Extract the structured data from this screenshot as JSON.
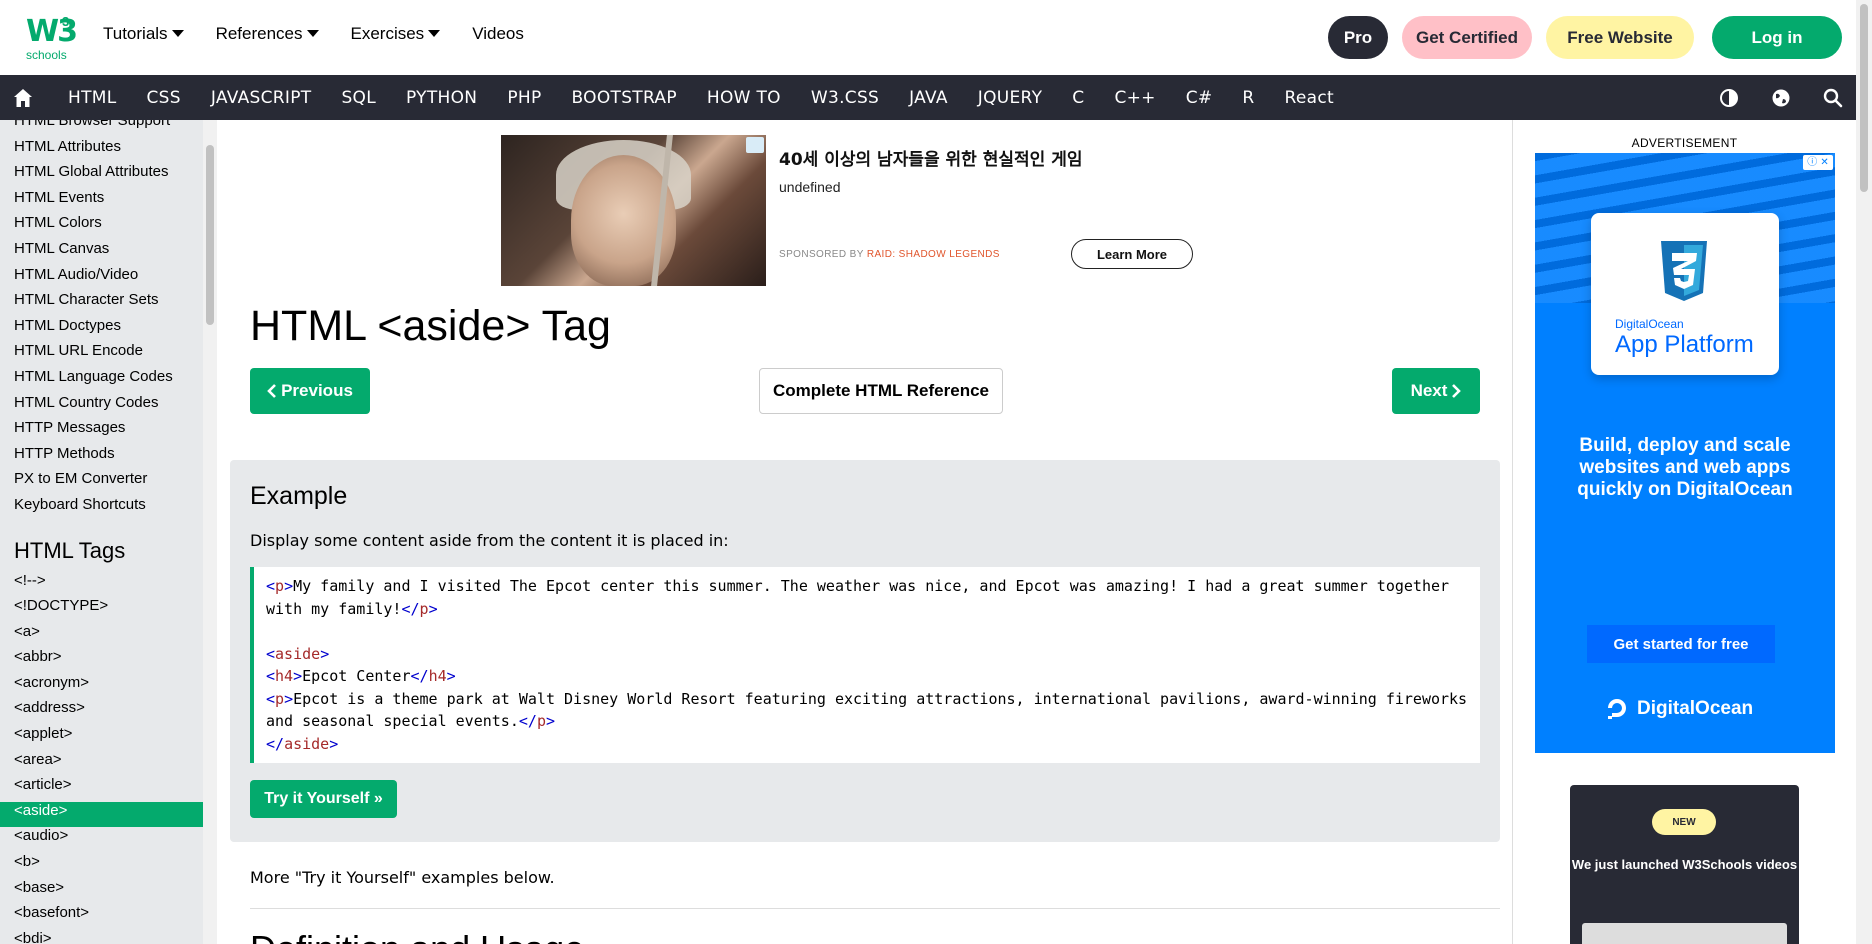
{
  "logo": {
    "w3": "W3",
    "sup": "3",
    "schools": "schools"
  },
  "topmenu": [
    {
      "label": "Tutorials"
    },
    {
      "label": "References"
    },
    {
      "label": "Exercises"
    },
    {
      "label": "Videos"
    }
  ],
  "top_buttons": {
    "pro": "Pro",
    "certified": "Get Certified",
    "free_website": "Free Website",
    "login": "Log in"
  },
  "nav": [
    "HTML",
    "CSS",
    "JAVASCRIPT",
    "SQL",
    "PYTHON",
    "PHP",
    "BOOTSTRAP",
    "HOW TO",
    "W3.CSS",
    "JAVA",
    "JQUERY",
    "C",
    "C++",
    "C#",
    "R",
    "React"
  ],
  "nav_icons": [
    "home-icon",
    "contrast-icon",
    "globe-icon",
    "search-icon"
  ],
  "sidebar": {
    "items_top": [
      "HTML Browser Support",
      "HTML Attributes",
      "HTML Global Attributes",
      "HTML Events",
      "HTML Colors",
      "HTML Canvas",
      "HTML Audio/Video",
      "HTML Character Sets",
      "HTML Doctypes",
      "HTML URL Encode",
      "HTML Language Codes",
      "HTML Country Codes",
      "HTTP Messages",
      "HTTP Methods",
      "PX to EM Converter",
      "Keyboard Shortcuts"
    ],
    "heading": "HTML Tags",
    "tags": [
      "<!-->",
      "<!DOCTYPE>",
      "<a>",
      "<abbr>",
      "<acronym>",
      "<address>",
      "<applet>",
      "<area>",
      "<article>",
      "<aside>",
      "<audio>",
      "<b>",
      "<base>",
      "<basefont>",
      "<bdi>"
    ],
    "active": "<aside>"
  },
  "ad_top": {
    "title": "40세 이상의 남자들을 위한 현실적인 게임",
    "subtitle": "undefined",
    "sponsored_prefix": "SPONSORED BY",
    "sponsor": "RAID: SHADOW LEGENDS",
    "cta": "Learn More"
  },
  "main": {
    "title": "HTML <aside> Tag",
    "prev": "Previous",
    "next": "Next",
    "reference": "Complete HTML Reference",
    "example_heading": "Example",
    "example_desc": "Display some content aside from the content it is placed in:",
    "try_button": "Try it Yourself »",
    "more": "More \"Try it Yourself\" examples below.",
    "next_heading": "Definition and Usage"
  },
  "code": {
    "p1_open": "p",
    "p1_text": "My family and I visited The Epcot center this summer. The weather was nice, and Epcot was amazing! I had a great summer together",
    "p1_text2": "with my family!",
    "p1_close": "p",
    "aside_open": "aside",
    "h4_open": "h4",
    "h4_text": "Epcot Center",
    "h4_close": "h4",
    "p2_open": "p",
    "p2_text": "Epcot is a theme park at Walt Disney World Resort featuring exciting attractions, international pavilions, award-winning fireworks",
    "p2_text2": "and seasonal special events.",
    "p2_close": "p",
    "aside_close": "aside"
  },
  "right_ad": {
    "label": "ADVERTISEMENT",
    "brand_small": "DigitalOcean",
    "brand_big": "App Platform",
    "tagline": "Build, deploy and scale websites and web apps quickly on DigitalOcean",
    "cta": "Get started for free",
    "logo_text": "DigitalOcean"
  },
  "video_ad": {
    "badge": "NEW",
    "text": "We just launched W3Schools videos"
  },
  "colors": {
    "brand_green": "#04aa6d",
    "nav_dark": "#282a35",
    "cert_pink": "#ffc0c7",
    "free_yellow": "#fff4a3",
    "do_blue": "#0080ff"
  }
}
